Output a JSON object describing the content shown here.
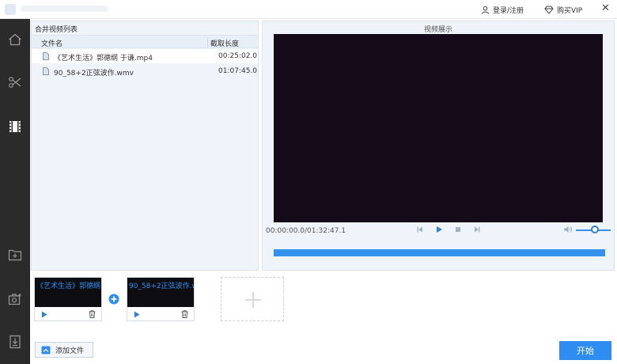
{
  "topbar": {
    "login_label": "登录/注册",
    "vip_label": "购买VIP",
    "close_glyph": "✕"
  },
  "sidebar": {
    "items": [
      {
        "name": "home-icon"
      },
      {
        "name": "scissors-icon"
      },
      {
        "name": "film-icon",
        "active": true
      },
      {
        "name": "add-folder-icon"
      },
      {
        "name": "camera-icon"
      },
      {
        "name": "download-icon"
      }
    ]
  },
  "merge_list": {
    "title": "合并视频列表",
    "col_name": "文件名",
    "col_duration": "截取长度",
    "rows": [
      {
        "name": "《艺术生活》郭德纲 于谦.mp4",
        "duration": "00:25:02.0"
      },
      {
        "name": "90_58+2正弦波作.wmv",
        "duration": "01:07:45.0"
      }
    ]
  },
  "preview": {
    "title": "视频展示",
    "time": "00:00:00.0/01:32:47.1",
    "volume": 0.55
  },
  "timeline": {
    "clips": [
      {
        "label": "《艺术生活》郭德纲"
      },
      {
        "label": "90_58+2正弦波作.w"
      }
    ],
    "add_file_label": "添加文件",
    "start_label": "开始"
  },
  "colors": {
    "accent": "#2f8cf0",
    "sidebar_bg": "#2b2b2b",
    "video_bg": "#150a17"
  }
}
